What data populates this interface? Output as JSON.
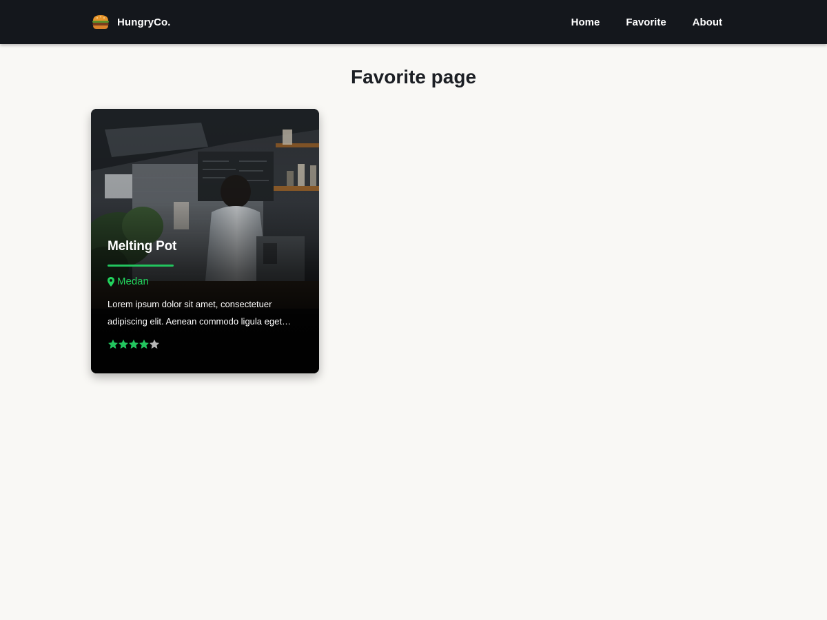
{
  "navbar": {
    "brand_name": "HungryCo.",
    "logo_icon": "burger-icon",
    "links": [
      {
        "label": "Home"
      },
      {
        "label": "Favorite"
      },
      {
        "label": "About"
      }
    ],
    "background": "#14171c"
  },
  "page": {
    "title": "Favorite page"
  },
  "restaurants": [
    {
      "name": "Melting Pot",
      "location_icon": "map-pin-icon",
      "city": "Medan",
      "description": "Lorem ipsum dolor sit amet, consectetuer adipiscing elit. Aenean commodo ligula eget dolor. Aenean massa. Cum sociis natoque penatibus et magnis dis parturient montes, nascetur ridiculus mus.",
      "rating": 4.2,
      "rating_max": 5,
      "photo": "restaurant-kitchen-photo"
    }
  ],
  "colors": {
    "accent": "#22c55e",
    "star_filled": "#22c55e",
    "star_empty": "#b5b5b5",
    "page_background": "#f9f8f5"
  }
}
